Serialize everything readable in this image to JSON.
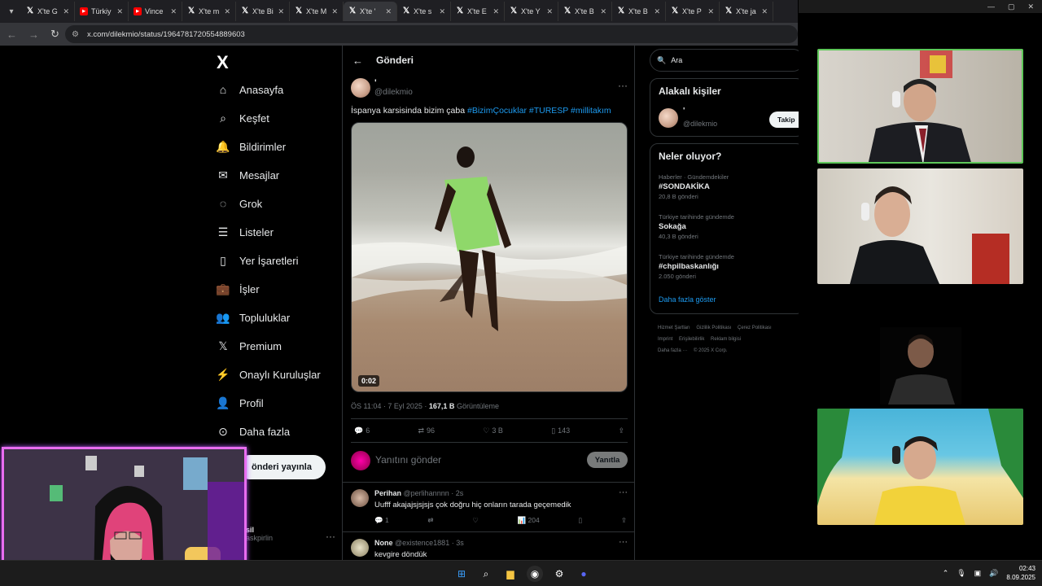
{
  "browser": {
    "tabs": [
      {
        "label": "X'te G",
        "icon": "x-icon"
      },
      {
        "label": "Türkiy",
        "icon": "youtube-icon"
      },
      {
        "label": "Vince",
        "icon": "youtube-icon"
      },
      {
        "label": "X'te m",
        "icon": "x-icon"
      },
      {
        "label": "X'te Bi",
        "icon": "x-icon"
      },
      {
        "label": "X'te M",
        "icon": "x-icon"
      },
      {
        "label": "X'te '",
        "icon": "x-icon",
        "active": true
      },
      {
        "label": "X'te s",
        "icon": "x-icon"
      },
      {
        "label": "X'te E",
        "icon": "x-icon"
      },
      {
        "label": "X'te Y",
        "icon": "x-icon"
      },
      {
        "label": "X'te B",
        "icon": "x-icon"
      },
      {
        "label": "X'te B",
        "icon": "x-icon"
      },
      {
        "label": "X'te P",
        "icon": "x-icon"
      },
      {
        "label": "X'te ja",
        "icon": "x-icon"
      }
    ],
    "url": "x.com/dilekmio/status/1964781720554889603"
  },
  "nav": {
    "logo": "X",
    "items": [
      {
        "label": "Anasayfa",
        "icon": "home-icon"
      },
      {
        "label": "Keşfet",
        "icon": "search-icon"
      },
      {
        "label": "Bildirimler",
        "icon": "bell-icon"
      },
      {
        "label": "Mesajlar",
        "icon": "mail-icon"
      },
      {
        "label": "Grok",
        "icon": "grok-icon"
      },
      {
        "label": "Listeler",
        "icon": "list-icon"
      },
      {
        "label": "Yer İşaretleri",
        "icon": "bookmark-icon"
      },
      {
        "label": "İşler",
        "icon": "briefcase-icon"
      },
      {
        "label": "Topluluklar",
        "icon": "people-icon"
      },
      {
        "label": "Premium",
        "icon": "x-icon"
      },
      {
        "label": "Onaylı Kuruluşlar",
        "icon": "lightning-icon"
      },
      {
        "label": "Profil",
        "icon": "person-icon"
      },
      {
        "label": "Daha fazla",
        "icon": "more-icon"
      }
    ],
    "post_button": "önderi yayınla",
    "account_name": "sil",
    "account_handle": "askpirlin"
  },
  "post": {
    "header_title": "Gönderi",
    "author_name": "'",
    "author_handle": "@dilekmio",
    "text": "İspanya karsisinda bizim çaba",
    "hashtags": [
      "#BizimÇocuklar",
      "#TURESP",
      "#millitakım"
    ],
    "video_duration": "0:02",
    "time": "ÖS 11:04 · 7 Eyl 2025 ·",
    "views_count": "167,1 B",
    "views_label": "Görüntüleme",
    "replies": "6",
    "reposts": "96",
    "likes": "3 B",
    "bookmarks": "143",
    "reply_placeholder": "Yanıtını gönder",
    "reply_button": "Yanıtla"
  },
  "replies": [
    {
      "name": "Perihan",
      "handle": "@perlihannnn",
      "time": "· 2s",
      "text": "Uufff akajajsjsjsjs çok doğru hiç onların tarada geçemedik",
      "replies": "1",
      "reposts": "",
      "likes": "",
      "views": "204"
    },
    {
      "name": "None",
      "handle": "@existence1881",
      "time": "· 3s",
      "text": "kevgire döndük"
    }
  ],
  "sidebar": {
    "search_placeholder": "Ara",
    "relevant_title": "Alakalı kişiler",
    "relevant_name": "'",
    "relevant_handle": "@dilekmio",
    "follow_button": "Takip",
    "trends_title": "Neler oluyor?",
    "trends": [
      {
        "context": "Haberler · Gündemdekiler",
        "title": "#SONDAKİKA",
        "posts": "20,8 B gönderi"
      },
      {
        "context": "Türkiye tarihinde gündemde",
        "title": "Sokağa",
        "posts": "40,3 B gönderi"
      },
      {
        "context": "Türkiye tarihinde gündemde",
        "title": "#chpilbaskanlığı",
        "posts": "2.050 gönderi"
      }
    ],
    "show_more": "Daha fazla göster",
    "footer": [
      "Hizmet Şartları",
      "Gizlilik Politikası",
      "Çerez Politikası",
      "Imprint",
      "Erişilebilirlik",
      "Reklam bilgisi",
      "Daha fazla ···",
      "© 2025 X Corp."
    ]
  },
  "taskbar": {
    "time": "02:43",
    "date": "8.09.2025"
  },
  "colors": {
    "accent": "#1d9bf0",
    "meet_active_border": "#5fc85a",
    "cam_border": "#e96df0"
  }
}
